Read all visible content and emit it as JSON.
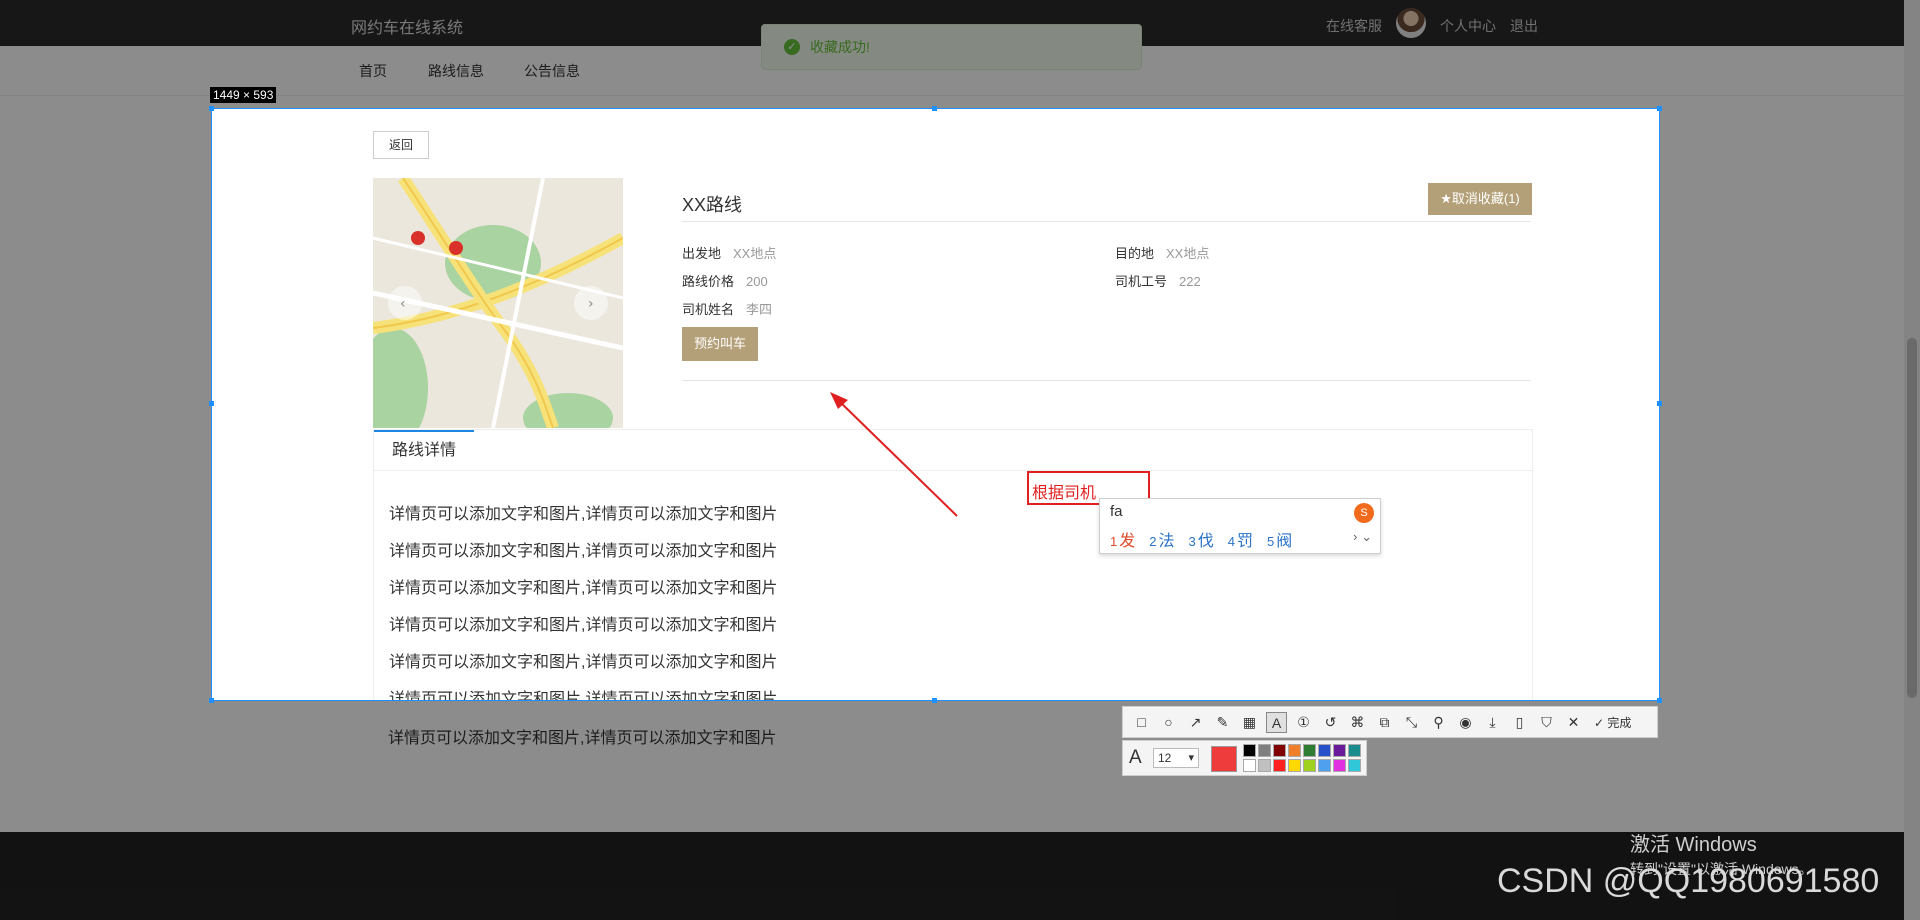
{
  "site": {
    "brand": "网约车在线系统",
    "header_links": [
      "在线客服",
      "个人中心",
      "退出"
    ],
    "nav": [
      "首页",
      "路线信息",
      "公告信息"
    ]
  },
  "toast": {
    "message": "收藏成功!"
  },
  "screenshot_tool": {
    "size_label": "1449 × 593",
    "done_label": "完成",
    "font_size": "12",
    "selected_color": "#ee3b3b",
    "palette": [
      "#000000",
      "#7f7f7f",
      "#800000",
      "#f07f2a",
      "#2e7d32",
      "#2850c8",
      "#6a1b9a",
      "#1a8c8c",
      "#ffffff",
      "#c0c0c0",
      "#ff2020",
      "#ffd800",
      "#a0d020",
      "#50a0f0",
      "#e030e0",
      "#30c8d8"
    ],
    "tools": [
      "rect-icon",
      "ellipse-icon",
      "arrow-icon",
      "pencil-icon",
      "mosaic-icon",
      "text-icon",
      "number-icon",
      "undo-icon",
      "ocr-icon",
      "translate-icon",
      "long-shot-icon",
      "pin-icon",
      "record-icon",
      "save-icon",
      "copy-icon",
      "bookmark-icon",
      "close-icon",
      "check-icon"
    ]
  },
  "detail": {
    "back_label": "返回",
    "route_title": "XX路线",
    "fav_label": "★取消收藏(1)",
    "fields": [
      {
        "label": "出发地",
        "value": "XX地点"
      },
      {
        "label": "目的地",
        "value": "XX地点"
      },
      {
        "label": "路线价格",
        "value": "200"
      },
      {
        "label": "司机工号",
        "value": "222"
      },
      {
        "label": "司机姓名",
        "value": "李四"
      }
    ],
    "book_label": "预约叫车",
    "tab_label": "路线详情",
    "detail_line": "详情页可以添加文字和图片,详情页可以添加文字和图片"
  },
  "annotation": {
    "text": "根据司机"
  },
  "ime": {
    "input": "fa",
    "candidates": [
      {
        "n": "1",
        "c": "发"
      },
      {
        "n": "2",
        "c": "法"
      },
      {
        "n": "3",
        "c": "伐"
      },
      {
        "n": "4",
        "c": "罚"
      },
      {
        "n": "5",
        "c": "阀"
      }
    ],
    "more": "› ⌄"
  },
  "watermarks": {
    "windows_line1": "激活 Windows",
    "windows_line2": "转到\"设置\"以激活 Windows。",
    "csdn": "CSDN @QQ1980691580"
  }
}
